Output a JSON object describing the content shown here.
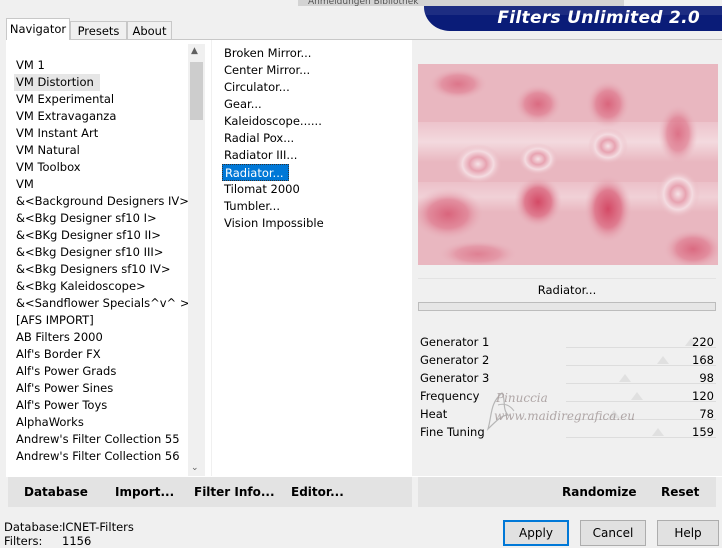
{
  "window": {
    "title": "Anmeldungen Bibliothek"
  },
  "brand": {
    "title": "Filters Unlimited 2.0"
  },
  "tabs": [
    {
      "label": "Navigator"
    },
    {
      "label": "Presets"
    },
    {
      "label": "About"
    }
  ],
  "categories": [
    "VM 1",
    "VM Distortion",
    "VM Experimental",
    "VM Extravaganza",
    "VM Instant Art",
    "VM Natural",
    "VM Toolbox",
    "VM",
    "&<Background Designers IV>",
    "&<Bkg Designer sf10 I>",
    "&<BKg Designer sf10 II>",
    "&<Bkg Designer sf10 III>",
    "&<Bkg Designers sf10 IV>",
    "&<Bkg Kaleidoscope>",
    "&<Sandflower Specials^v^ >",
    "[AFS IMPORT]",
    "AB Filters 2000",
    "Alf's Border FX",
    "Alf's Power Grads",
    "Alf's Power Sines",
    "Alf's Power Toys",
    "AlphaWorks",
    "Andrew's Filter Collection 55",
    "Andrew's Filter Collection 56"
  ],
  "selected_category": "VM Distortion",
  "filters": [
    "Broken Mirror...",
    "Center Mirror...",
    "Circulator...",
    "Gear...",
    "Kaleidoscope......",
    "Radial Pox...",
    "Radiator III...",
    "Radiator...",
    "Tilomat 2000",
    "Tumbler...",
    "Vision Impossible"
  ],
  "selected_filter": "Radiator...",
  "preview": {
    "current_filter": "Radiator..."
  },
  "params": [
    {
      "label": "Generator 1",
      "value": 220
    },
    {
      "label": "Generator 2",
      "value": 168
    },
    {
      "label": "Generator 3",
      "value": 98
    },
    {
      "label": "Frequency",
      "value": 120
    },
    {
      "label": "Heat",
      "value": 78
    },
    {
      "label": "Fine Tuning",
      "value": 159
    }
  ],
  "watermark": {
    "line1": "Pinuccia",
    "line2": "www.maidiregrafica.eu"
  },
  "left_buttons": {
    "database": "Database",
    "import": "Import...",
    "filter_info": "Filter Info...",
    "editor": "Editor..."
  },
  "right_buttons": {
    "randomize": "Randomize",
    "reset": "Reset"
  },
  "status": {
    "database_label": "Database:",
    "database_value": "ICNET-Filters",
    "filters_label": "Filters:",
    "filters_value": "1156"
  },
  "dialog_buttons": {
    "apply": "Apply",
    "cancel": "Cancel",
    "help": "Help"
  },
  "colors": {
    "accent": "#0078d7",
    "brand_bg": "#0a1c78",
    "preview_light": "#e9b7c0",
    "preview_dark": "#d44a66"
  }
}
